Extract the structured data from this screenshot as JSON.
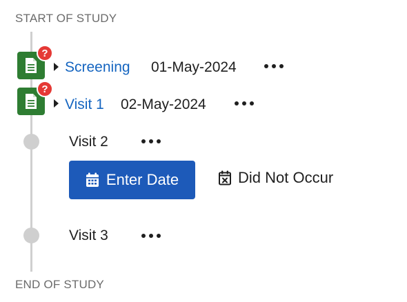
{
  "timeline": {
    "start_label": "START OF STUDY",
    "end_label": "END OF STUDY"
  },
  "visits": [
    {
      "name": "Screening",
      "date": "01-May-2024",
      "linked": true,
      "has_query": true,
      "more_label": "•••"
    },
    {
      "name": "Visit 1",
      "date": "02-May-2024",
      "linked": true,
      "has_query": true,
      "more_label": "•••"
    },
    {
      "name": "Visit 2",
      "date": "",
      "linked": false,
      "has_query": false
    },
    {
      "name": "Visit 3",
      "date": "",
      "linked": false,
      "has_query": false
    }
  ],
  "actions": {
    "enter_date_label": "Enter Date",
    "did_not_occur_label": "Did Not Occur"
  },
  "badges": {
    "query_symbol": "?"
  },
  "colors": {
    "link": "#1565c0",
    "doc_badge": "#2e7d32",
    "query_badge": "#e53935",
    "primary_button": "#1d5ab9",
    "timeline": "#cfcfcf"
  },
  "icons": {
    "doc": "document-icon",
    "query": "question-badge-icon",
    "calendar": "calendar-icon",
    "calendar_x": "calendar-x-icon",
    "more": "more-horizontal-icon",
    "caret": "caret-right-icon"
  }
}
